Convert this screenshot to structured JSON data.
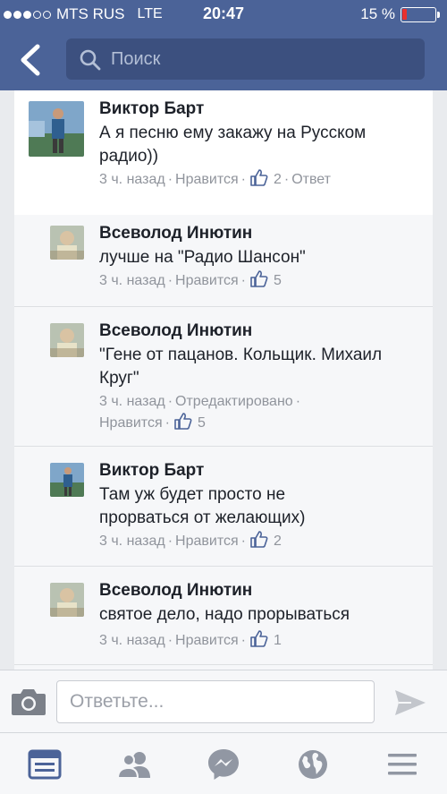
{
  "status_bar": {
    "carrier": "MTS RUS",
    "network": "LTE",
    "time": "20:47",
    "battery_percent": "15 %",
    "battery_level": 0.15,
    "battery_color": "#e8302e"
  },
  "header": {
    "search_placeholder": "Поиск",
    "background_color": "#4b6398"
  },
  "comments": [
    {
      "name": "Виктор Барт",
      "text": "А я песню ему закажу на Русском радио))",
      "meta": {
        "time": "3 ч. назад",
        "like_label": "Нравится",
        "likes": "2",
        "reply_label": "Ответ"
      }
    },
    {
      "name": "Всеволод Инютин",
      "text": "лучше на \"Радио Шансон\"",
      "meta": {
        "time": "3 ч. назад",
        "like_label": "Нравится",
        "likes": "5"
      }
    },
    {
      "name": "Всеволод Инютин",
      "text": "\"Гене от пацанов. Кольщик. Михаил Круг\"",
      "meta": {
        "time": "3 ч. назад",
        "edited_label": "Отредактировано",
        "like_label": "Нравится",
        "likes": "5"
      }
    },
    {
      "name": "Виктор Барт",
      "text": "Там уж будет просто не прорваться от желающих)",
      "meta": {
        "time": "3 ч. назад",
        "like_label": "Нравится",
        "likes": "2"
      }
    },
    {
      "name": "Всеволод Инютин",
      "text": "святое дело, надо прорываться",
      "meta": {
        "time": "3 ч. назад",
        "like_label": "Нравится",
        "likes": "1"
      }
    }
  ],
  "reply_bar": {
    "placeholder": "Ответьте...",
    "camera_icon": "camera-icon",
    "send_icon": "send-icon"
  },
  "tabbar": {
    "tabs": [
      {
        "icon": "news-feed-icon",
        "active": true
      },
      {
        "icon": "friends-icon",
        "active": false
      },
      {
        "icon": "messenger-icon",
        "active": false
      },
      {
        "icon": "globe-icon",
        "active": false
      },
      {
        "icon": "menu-icon",
        "active": false
      }
    ],
    "active_color": "#4b6398",
    "inactive_color": "#9197a3"
  }
}
